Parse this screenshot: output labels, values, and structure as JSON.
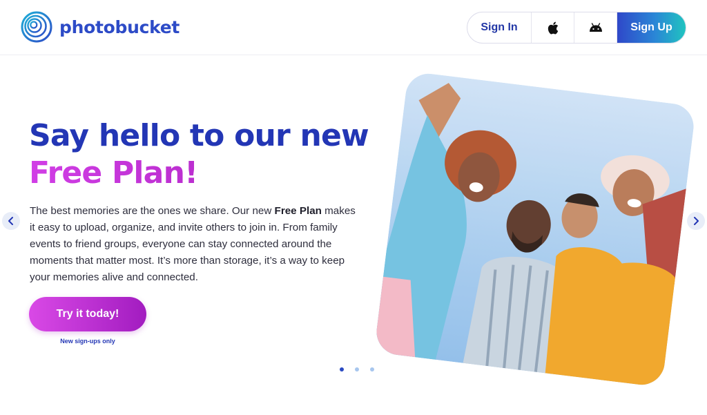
{
  "header": {
    "brand": "photobucket",
    "sign_in": "Sign In",
    "sign_up": "Sign Up",
    "apple_icon": "apple-icon",
    "android_icon": "android-icon"
  },
  "hero": {
    "title_line1": "Say hello to our new",
    "title_line2": "Free Plan!",
    "body_part1": "The best memories are the ones we share. Our new ",
    "body_bold": "Free Plan",
    "body_part2": " makes it easy to upload, organize, and invite others to join in. From family events to friend groups, everyone can stay connected around the moments that matter most. It’s more than storage, it’s a way to keep your memories alive and connected.",
    "cta": "Try it today!",
    "cta_note": "New sign-ups only"
  },
  "carousel": {
    "slides": 3,
    "active": 1
  },
  "colors": {
    "brand_blue": "#2336b5",
    "brand_magenta": "#c333d6",
    "signup_gradient_end": "#20c4c0"
  }
}
